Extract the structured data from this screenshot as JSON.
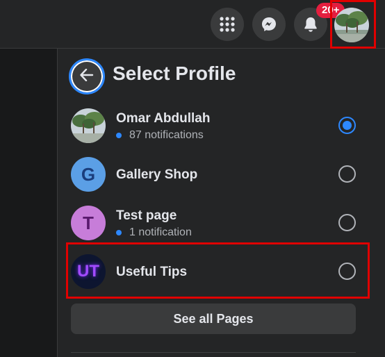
{
  "topbar": {
    "icons": [
      "menu-grid-icon",
      "messenger-icon",
      "bell-icon"
    ],
    "notification_badge": "20+",
    "colors": {
      "badge": "#e41e3f",
      "button_bg": "#3a3b3c"
    }
  },
  "panel": {
    "title": "Select Profile",
    "back_icon": "arrow-left-icon",
    "profiles": [
      {
        "name": "Omar Abdullah",
        "sub": "87 notifications",
        "selected": true,
        "avatar": "photo"
      },
      {
        "name": "Gallery Shop",
        "sub": "",
        "selected": false,
        "avatar": "G"
      },
      {
        "name": "Test page",
        "sub": "1 notification",
        "selected": false,
        "avatar": "T"
      },
      {
        "name": "Useful Tips",
        "sub": "",
        "selected": false,
        "avatar": "UT"
      }
    ],
    "see_all_label": "See all Pages"
  },
  "colors": {
    "accent": "#2d88ff",
    "highlight": "#e00000",
    "panel_bg": "#242526"
  }
}
